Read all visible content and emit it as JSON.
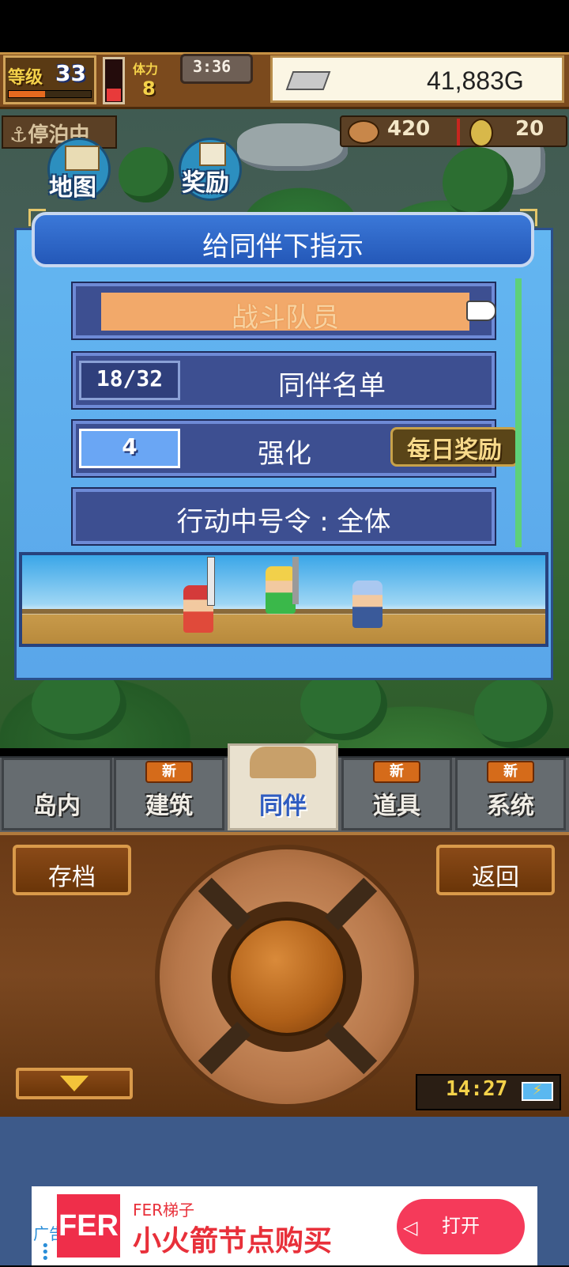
{
  "hud": {
    "level_label": "等级",
    "level": "33",
    "stamina_label": "体力",
    "stamina": "8",
    "clock": "3:36",
    "gold": "41,883G",
    "dock_status": "停泊中",
    "resource1": "420",
    "resource2": "20"
  },
  "quick_buttons": {
    "map": "地图",
    "reward": "奖励"
  },
  "dialog": {
    "title": "给同伴下指示",
    "items": [
      {
        "label": "战斗队员",
        "selected": true
      },
      {
        "label": "同伴名单",
        "badge": "18/32"
      },
      {
        "label": "强化",
        "badge": "4",
        "extra_badge": "每日奖励"
      },
      {
        "label": "行动中号令 : 全体"
      }
    ]
  },
  "tabs": [
    {
      "label": "岛内",
      "new": false,
      "active": false
    },
    {
      "label": "建筑",
      "new": true,
      "new_label": "新",
      "active": false
    },
    {
      "label": "同伴",
      "new": false,
      "active": true
    },
    {
      "label": "道具",
      "new": true,
      "new_label": "新",
      "active": false
    },
    {
      "label": "系统",
      "new": true,
      "new_label": "新",
      "active": false
    }
  ],
  "controls": {
    "save": "存档",
    "back": "返回",
    "time": "14:27"
  },
  "ad": {
    "tag": "广告",
    "logo": "FER",
    "brand": "FER梯子",
    "title": "小火箭节点购买",
    "open_button": "打开"
  },
  "colors": {
    "dialog_bg": "#5aa6ea",
    "title_bar": "#2458b8",
    "highlight": "#f2a96a",
    "ad_accent": "#f53a5a"
  }
}
